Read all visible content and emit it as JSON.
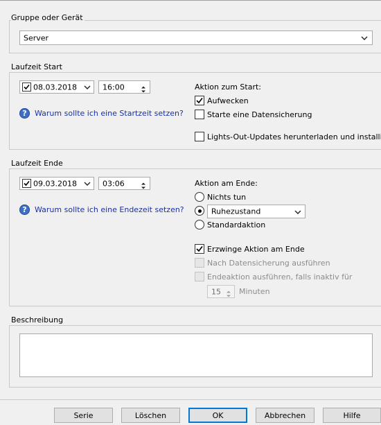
{
  "group": {
    "label": "Gruppe oder Gerät",
    "selected": "Server"
  },
  "start": {
    "section_label": "Laufzeit Start",
    "date": "08.03.2018",
    "time": "16:00",
    "help_link": "Warum sollte ich eine Startzeit setzen?",
    "action_label": "Aktion zum Start:",
    "options": {
      "wake": "Aufwecken",
      "backup": "Starte eine Datensicherung",
      "lights_out": "Lights-Out-Updates herunterladen und installieren"
    }
  },
  "end": {
    "section_label": "Laufzeit Ende",
    "date": "09.03.2018",
    "time": "03:06",
    "help_link": "Warum sollte ich eine Endezeit setzen?",
    "action_label": "Aktion am Ende:",
    "radio_nothing": "Nichts tun",
    "radio_selected_value": "Ruhezustand",
    "radio_standard": "Standardaktion",
    "force_action": "Erzwinge Aktion am Ende",
    "after_backup": "Nach Datensicherung ausführen",
    "if_inactive": "Endeaktion ausführen, falls inaktiv für",
    "minutes_value": "15",
    "minutes_label": "Minuten"
  },
  "description": {
    "label": "Beschreibung",
    "text": ""
  },
  "buttons": {
    "serie": "Serie",
    "delete": "Löschen",
    "ok": "OK",
    "cancel": "Abbrechen",
    "help": "Hilfe"
  }
}
